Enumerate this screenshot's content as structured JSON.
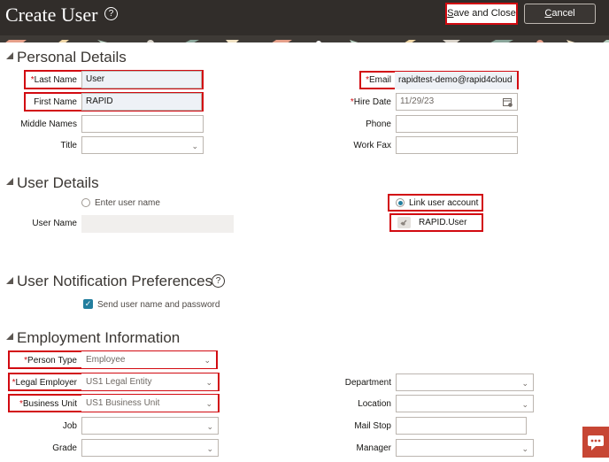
{
  "header": {
    "title": "Create User",
    "save_label": "Save and Close",
    "save_mnemonic": "S",
    "save_rest": "ave and Close",
    "cancel_mnemonic": "C",
    "cancel_rest": "ancel"
  },
  "personal": {
    "title": "Personal Details",
    "last_name_label": "Last Name",
    "last_name_value": "User",
    "first_name_label": "First Name",
    "first_name_value": "RAPID",
    "middle_names_label": "Middle Names",
    "middle_names_value": "",
    "title_label": "Title",
    "title_value": "",
    "email_label": "Email",
    "email_value": "rapidtest-demo@rapid4cloud",
    "hire_date_label": "Hire Date",
    "hire_date_value": "11/29/23",
    "phone_label": "Phone",
    "phone_value": "",
    "work_fax_label": "Work Fax",
    "work_fax_value": ""
  },
  "user": {
    "title": "User Details",
    "enter_user_name": "Enter user name",
    "user_name_label": "User Name",
    "user_name_value": "",
    "link_account": "Link user account",
    "linked_account_value": "RAPID.User"
  },
  "notification": {
    "title": "User Notification Preferences",
    "send_label": "Send user name and password",
    "send_checked": true
  },
  "employment": {
    "title": "Employment Information",
    "person_type_label": "Person Type",
    "person_type_value": "Employee",
    "legal_employer_label": "Legal Employer",
    "legal_employer_value": "US1 Legal Entity",
    "business_unit_label": "Business Unit",
    "business_unit_value": "US1 Business Unit",
    "job_label": "Job",
    "job_value": "",
    "grade_label": "Grade",
    "grade_value": "",
    "department_label": "Department",
    "department_value": "",
    "location_label": "Location",
    "location_value": "",
    "mail_stop_label": "Mail Stop",
    "mail_stop_value": "",
    "manager_label": "Manager",
    "manager_value": ""
  },
  "colors": {
    "header_bg": "#312d2a",
    "required": "#d20a11",
    "highlight_box": "#d20a11",
    "accent": "#227e9e",
    "chat_button": "#c74634"
  },
  "icons": {
    "help": "help-circle-icon",
    "calendar": "calendar-icon",
    "link": "link-icon",
    "dropdown": "chevron-down-icon",
    "collapse": "disclosure-triangle-icon",
    "chat": "chat-icon"
  }
}
